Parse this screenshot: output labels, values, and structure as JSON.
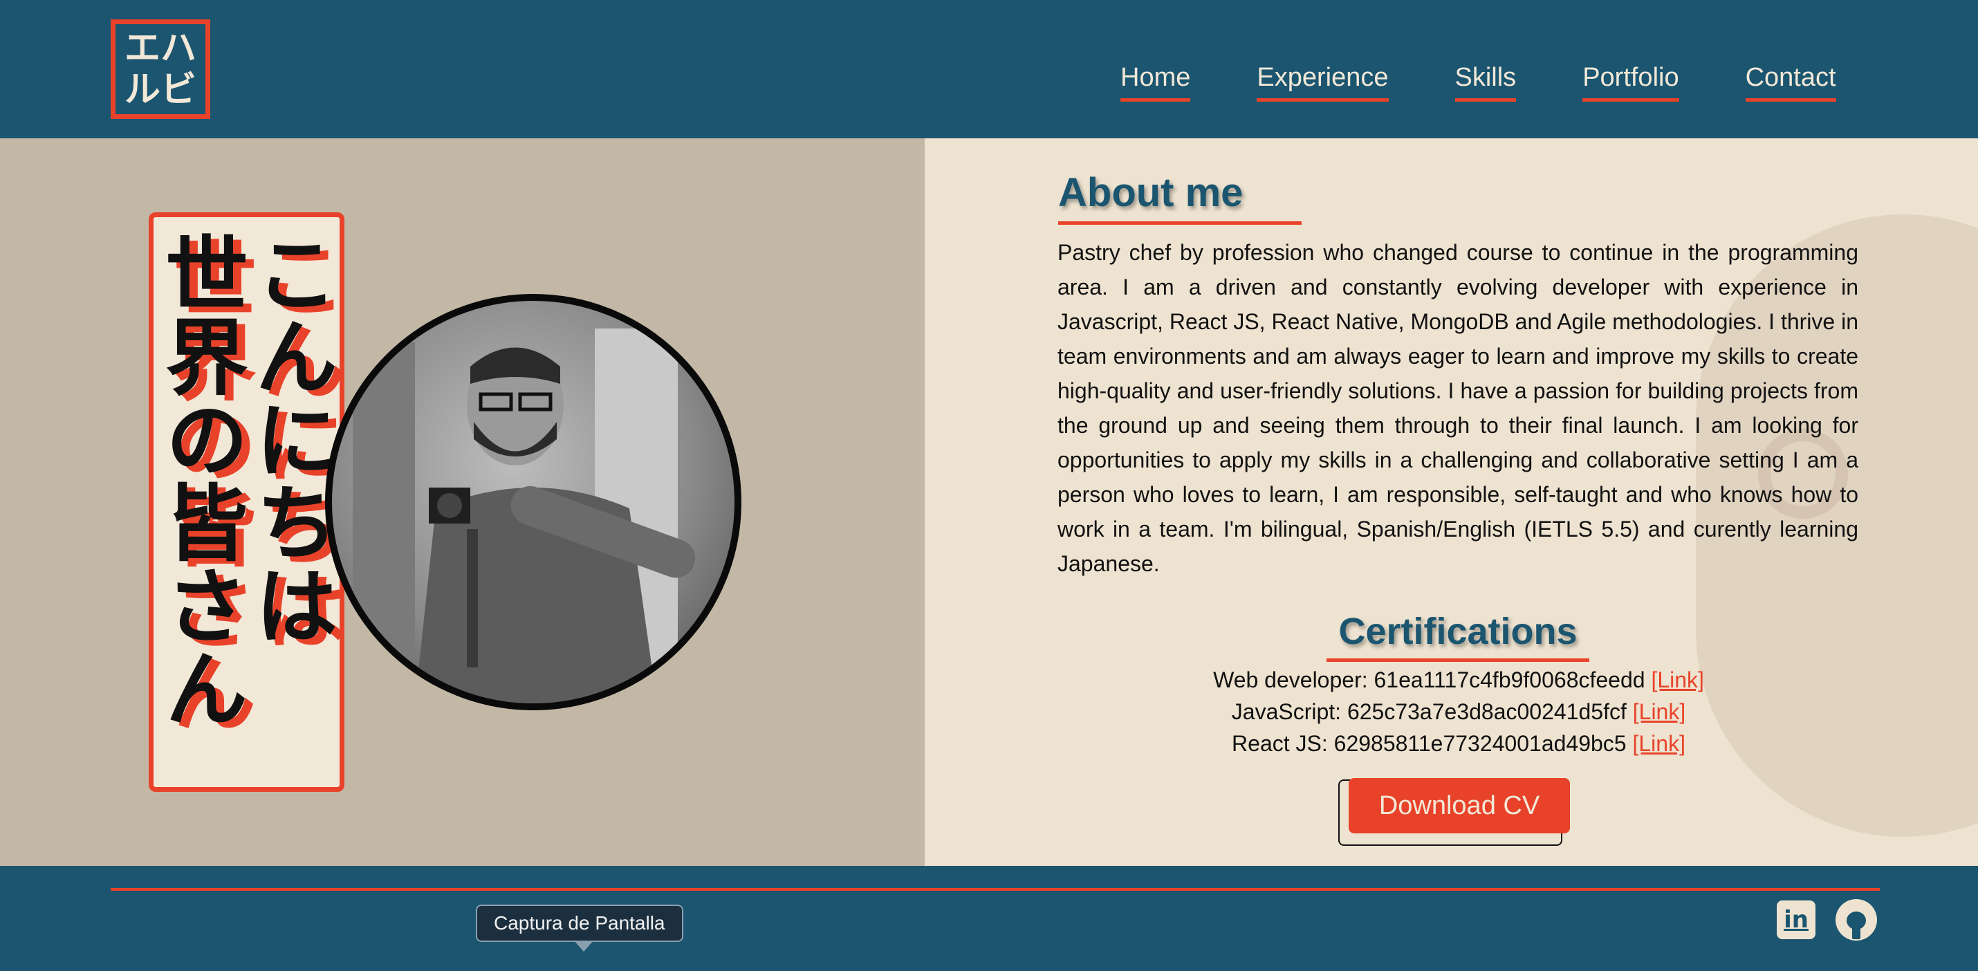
{
  "header": {
    "logo": [
      "エハ",
      "ルビ"
    ],
    "nav": [
      "Home",
      "Experience",
      "Skills",
      "Portfolio",
      "Contact"
    ]
  },
  "hero": {
    "col_right": "こんにちは",
    "col_left": "世界の皆さん"
  },
  "about": {
    "title": "About me",
    "text": "Pastry chef by profession who changed course to continue in the programming area. I am a driven and constantly evolving developer with experience in Javascript, React JS, React Native, MongoDB and Agile methodologies. I thrive in team environments and am always eager to learn and improve my skills to create high-quality and user-friendly solutions. I have a passion for building projects from the ground up and seeing them through to their final launch. I am looking for opportunities to apply my skills in a challenging and collaborative setting I am a person who loves to learn, I am responsible, self-taught and who knows how to work in a team. I'm bilingual, Spanish/English (IETLS 5.5) and curently learning Japanese."
  },
  "certifications": {
    "title": "Certifications",
    "items": [
      {
        "label": "Web developer: 61ea1117c4fb9f0068cfeedd",
        "link": "[Link]"
      },
      {
        "label": "JavaScript: 625c73a7e3d8ac00241d5fcf",
        "link": "[Link]"
      },
      {
        "label": "React JS: 62985811e77324001ad49bc5",
        "link": "[Link]"
      }
    ]
  },
  "cv_button": "Download CV",
  "footer": {
    "tooltip": "Captura de Pantalla",
    "linkedin": "in"
  },
  "colors": {
    "primary": "#1b5570",
    "accent": "#e8432a",
    "cream": "#eee3d0",
    "tan": "#c3b8a6"
  },
  "icons": [
    "linkedin-icon",
    "github-icon"
  ]
}
